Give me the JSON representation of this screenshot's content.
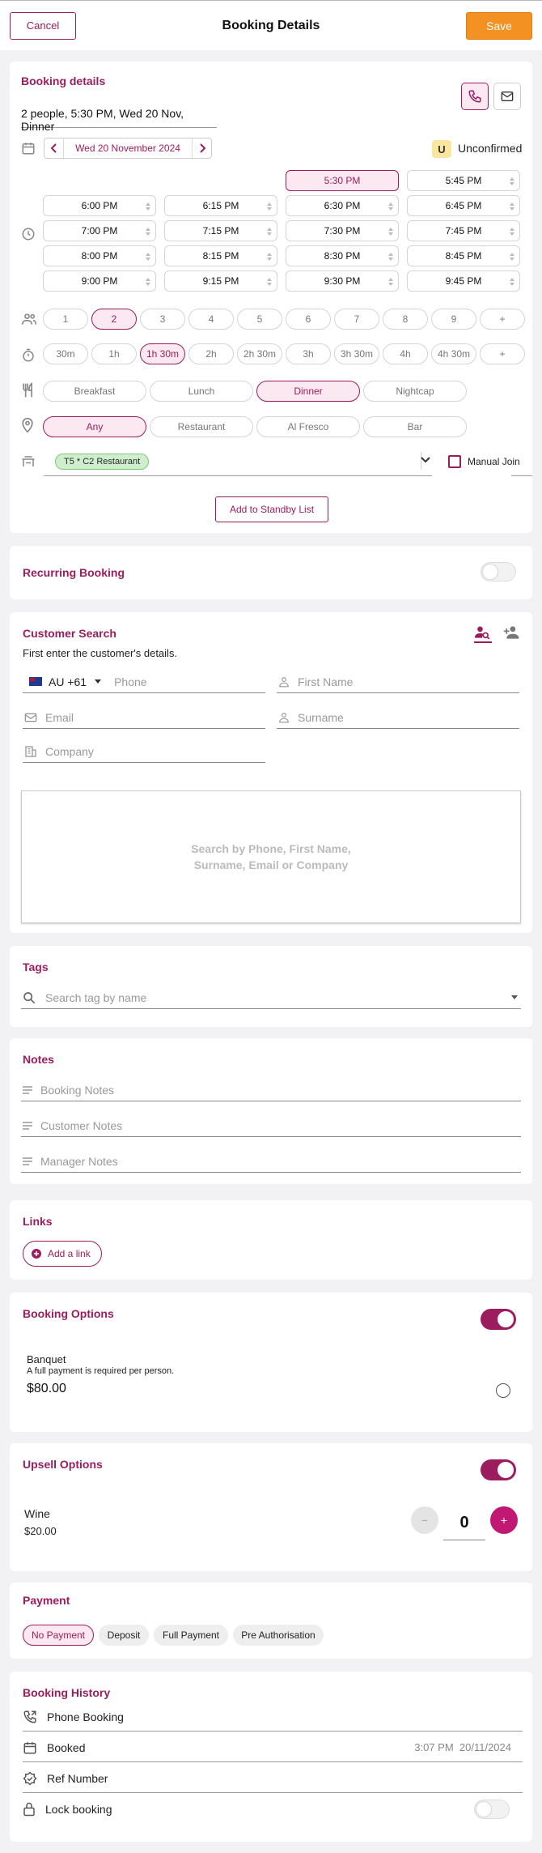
{
  "header": {
    "cancel_label": "Cancel",
    "title": "Booking Details",
    "save_label": "Save"
  },
  "booking_details": {
    "title": "Booking details",
    "summary": "2 people, 5:30 PM, Wed 20 Nov, Dinner",
    "date": "Wed 20 November 2024",
    "status_badge": "U",
    "status": "Unconfirmed",
    "times": [
      {
        "label": "5:30 PM",
        "selected": true
      },
      {
        "label": "5:45 PM"
      },
      {
        "label": "6:00 PM"
      },
      {
        "label": "6:15 PM"
      },
      {
        "label": "6:30 PM"
      },
      {
        "label": "6:45 PM"
      },
      {
        "label": "7:00 PM"
      },
      {
        "label": "7:15 PM"
      },
      {
        "label": "7:30 PM"
      },
      {
        "label": "7:45 PM"
      },
      {
        "label": "8:00 PM"
      },
      {
        "label": "8:15 PM"
      },
      {
        "label": "8:30 PM"
      },
      {
        "label": "8:45 PM"
      },
      {
        "label": "9:00 PM"
      },
      {
        "label": "9:15 PM"
      },
      {
        "label": "9:30 PM"
      },
      {
        "label": "9:45 PM"
      }
    ],
    "party_sizes": [
      "1",
      "2",
      "3",
      "4",
      "5",
      "6",
      "7",
      "8",
      "9",
      "+"
    ],
    "selected_party": "2",
    "durations": [
      "30m",
      "1h",
      "1h 30m",
      "2h",
      "2h 30m",
      "3h",
      "3h 30m",
      "4h",
      "4h 30m",
      "+"
    ],
    "selected_duration": "1h 30m",
    "services": [
      "Breakfast",
      "Lunch",
      "Dinner",
      "Nightcap"
    ],
    "selected_service": "Dinner",
    "areas": [
      "Any",
      "Restaurant",
      "Al Fresco",
      "Bar"
    ],
    "selected_area": "Any",
    "table_tag": "T5 * C2 Restaurant",
    "manual_join_label": "Manual Join",
    "standby_label": "Add to Standby List"
  },
  "recurring": {
    "title": "Recurring Booking"
  },
  "customer": {
    "title": "Customer Search",
    "hint": "First enter the customer's details.",
    "country_code": "AU +61",
    "phone_placeholder": "Phone",
    "first_name_placeholder": "First Name",
    "email_placeholder": "Email",
    "surname_placeholder": "Surname",
    "company_placeholder": "Company",
    "search_hint": "Search by Phone, First Name, Surname, Email or Company"
  },
  "tags": {
    "title": "Tags",
    "placeholder": "Search tag by name"
  },
  "notes": {
    "title": "Notes",
    "booking": "Booking Notes",
    "customer": "Customer Notes",
    "manager": "Manager Notes"
  },
  "links": {
    "title": "Links",
    "add_label": "Add a link"
  },
  "booking_options": {
    "title": "Booking Options",
    "item_name": "Banquet",
    "item_desc": "A full payment is required per person.",
    "item_price": "$80.00"
  },
  "upsell": {
    "title": "Upsell Options",
    "item_name": "Wine",
    "item_price": "$20.00",
    "qty": "0",
    "minus": "−",
    "plus": "+"
  },
  "payment": {
    "title": "Payment",
    "options": [
      "No Payment",
      "Deposit",
      "Full Payment",
      "Pre Authorisation"
    ],
    "selected": "No Payment"
  },
  "history": {
    "title": "Booking History",
    "source": "Phone Booking",
    "booked_label": "Booked",
    "booked_time": "3:07 PM  20/11/2024",
    "ref_label": "Ref Number",
    "lock_label": "Lock booking"
  },
  "colors": {
    "accent": "#9b1d5e",
    "save": "#f39122",
    "tag_green": "#cfeecd"
  }
}
